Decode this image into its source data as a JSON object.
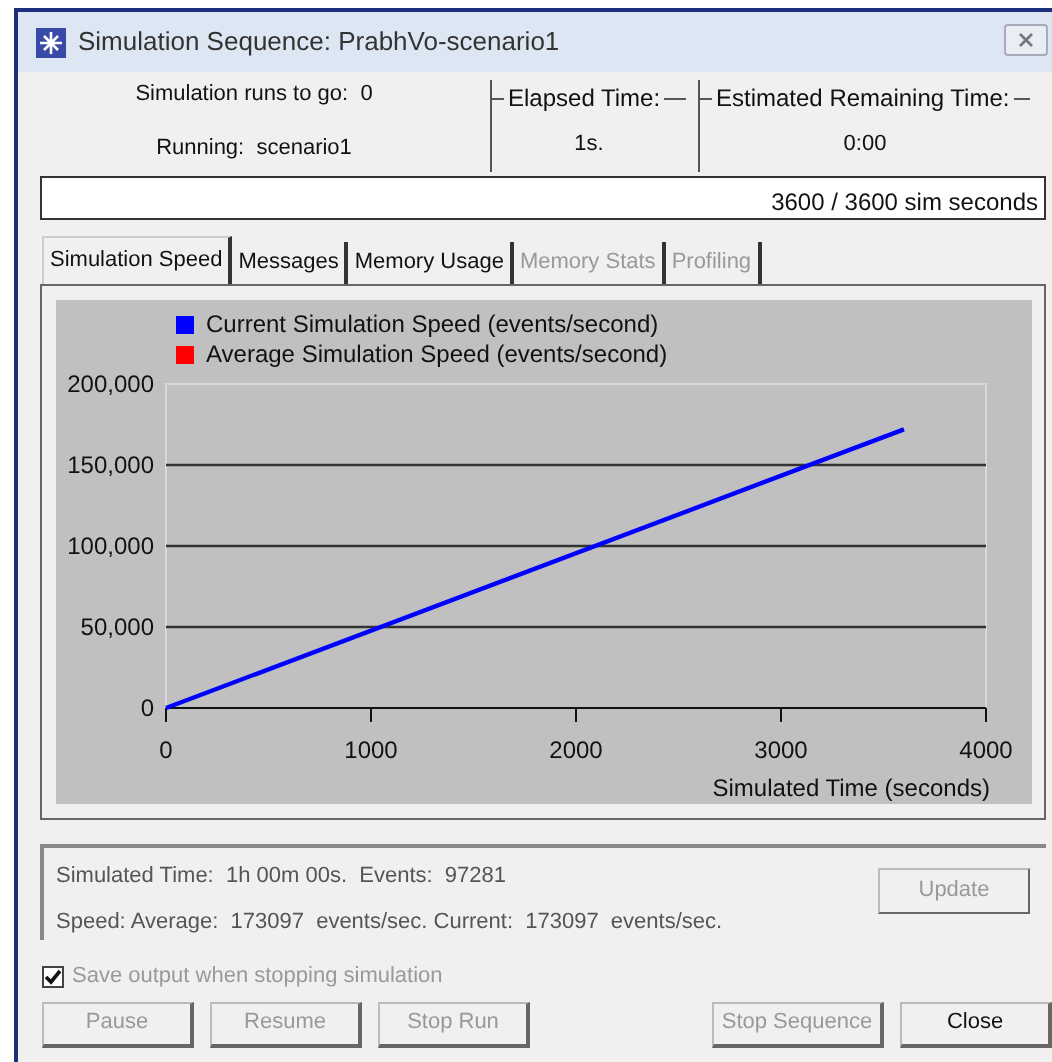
{
  "window": {
    "title": "Simulation Sequence: PrabhVo-scenario1"
  },
  "runs_to_go": {
    "label": "Simulation runs to go:",
    "value": "0"
  },
  "running": {
    "label": "Running:",
    "value": "scenario1"
  },
  "elapsed_time": {
    "label": "Elapsed Time:",
    "value": "1s."
  },
  "remaining_time": {
    "label": "Estimated Remaining Time:",
    "value": "0:00"
  },
  "progress": {
    "level": 1.0,
    "text": "3600 / 3600 sim seconds"
  },
  "tabs": [
    {
      "label": "Simulation Speed",
      "selected": true,
      "disabled": false
    },
    {
      "label": "Messages",
      "selected": false,
      "disabled": false
    },
    {
      "label": "Memory Usage",
      "selected": false,
      "disabled": false
    },
    {
      "label": "Memory Stats",
      "selected": false,
      "disabled": true
    },
    {
      "label": "Profiling",
      "selected": false,
      "disabled": true
    }
  ],
  "chart_data": {
    "type": "line",
    "xlabel": "Simulated Time (seconds)",
    "x": [
      0,
      3600
    ],
    "series": [
      {
        "name": "Current Simulation Speed (events/second)",
        "color": "#0000ff",
        "values": [
          0,
          172000
        ]
      },
      {
        "name": "Average Simulation Speed (events/second)",
        "color": "#ff0000",
        "values": [
          null,
          null
        ]
      }
    ],
    "grid": true,
    "xlim": [
      0,
      4000
    ],
    "ylim": [
      0,
      200000
    ],
    "xticks": [
      0,
      1000,
      2000,
      3000,
      4000
    ],
    "yticks": [
      {
        "value": 0,
        "label": "0"
      },
      {
        "value": 50000,
        "label": "50,000"
      },
      {
        "value": 100000,
        "label": "100,000"
      },
      {
        "value": 150000,
        "label": "150,000"
      },
      {
        "value": 200000,
        "label": "200,000"
      }
    ]
  },
  "status": {
    "line_1": "Simulated Time:  1h 00m 00s.  Events:  97281",
    "line_2": "Speed: Average:  173097  events/sec. Current:  173097  events/sec."
  },
  "update_button": {
    "label": "Update",
    "disabled": true
  },
  "save_output": {
    "label": "Save output when stopping simulation",
    "checked": true,
    "disabled": true
  },
  "buttons": [
    {
      "label": "Pause",
      "disabled": true
    },
    {
      "label": "Resume",
      "disabled": true
    },
    {
      "label": "Stop Run",
      "disabled": true
    },
    {
      "label": "Stop Sequence",
      "disabled": true
    },
    {
      "label": "Close",
      "disabled": false
    }
  ]
}
